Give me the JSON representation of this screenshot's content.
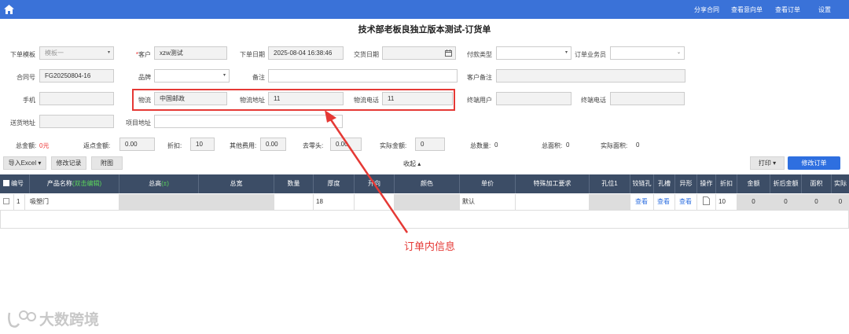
{
  "topbar": {
    "share": "分享合同",
    "view_intent": "查看意向单",
    "view_order": "查看订单",
    "settings": "设置"
  },
  "page_title": "技术部老板良独立版本测试-订货单",
  "form": {
    "template_label": "下单模板",
    "template_value": "模板一",
    "customer_label": "客户",
    "customer_value": "xzw测试",
    "order_date_label": "下单日期",
    "order_date_value": "2025-08-04 16:38:46",
    "delivery_date_label": "交货日期",
    "delivery_date_value": "",
    "payment_label": "付款类型",
    "payment_value": "",
    "salesman_label": "订单业务员",
    "salesman_value": "",
    "contract_label": "合同号",
    "contract_value": "FG20250804-16",
    "brand_label": "品牌",
    "brand_value": "",
    "remark_label": "备注",
    "remark_value": "",
    "cust_remark_label": "客户备注",
    "cust_remark_value": "",
    "phone_label": "手机",
    "phone_value": "",
    "logistics_label": "物流",
    "logistics_value": "中国邮政",
    "logistics_addr_label": "物流地址",
    "logistics_addr_value": "11",
    "logistics_phone_label": "物流电话",
    "logistics_phone_value": "11",
    "end_user_label": "终端用户",
    "end_user_value": "",
    "end_phone_label": "终端电话",
    "end_phone_value": "",
    "ship_addr_label": "送货地址",
    "ship_addr_value": "",
    "project_addr_label": "项目地址",
    "project_addr_value": ""
  },
  "summary": {
    "total_label": "总金额:",
    "total_value": "0元",
    "rebate_label": "返点金额:",
    "rebate_value": "0.00",
    "discount_label": "折扣:",
    "discount_value": "10",
    "other_fee_label": "其他费用:",
    "other_fee_value": "0.00",
    "round_label": "去零头:",
    "round_value": "0.00",
    "actual_label": "实际金额:",
    "actual_value": "0",
    "qty_label": "总数量:",
    "qty_value": "0",
    "area_label": "总面积:",
    "area_value": "0",
    "actual_area_label": "实际面积:",
    "actual_area_value": "0"
  },
  "toolbar": {
    "import": "导入Excel",
    "history": "修改记录",
    "attach": "附图",
    "collapse": "收起",
    "print": "打印",
    "modify": "修改订单"
  },
  "table": {
    "headers": [
      "编号",
      "产品名称",
      "总高",
      "总宽",
      "数量",
      "厚度",
      "开向",
      "颜色",
      "单价",
      "特殊加工要求",
      "孔位1",
      "铰链孔",
      "孔槽",
      "异形",
      "操作",
      "折扣",
      "金额",
      "折后金额",
      "面积",
      "实际"
    ],
    "product_hint": "(双击编辑)",
    "height_hint": "(±)",
    "row": {
      "no": "1",
      "name": "吸塑门",
      "thickness": "18",
      "price": "默认",
      "view1": "查看",
      "view2": "查看",
      "view3": "查看",
      "discount": "10",
      "amount": "0",
      "after": "0",
      "area": "0",
      "actual": "0"
    }
  },
  "annotation": {
    "text": "订单内信息",
    "color": "#e53935"
  },
  "watermark": "大数跨境"
}
